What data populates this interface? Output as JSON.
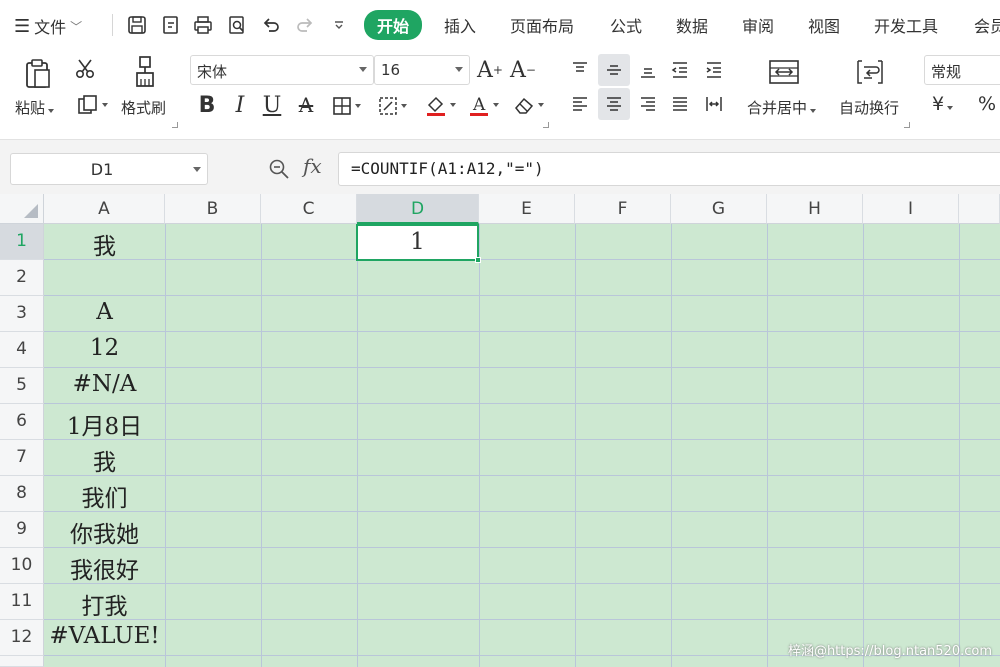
{
  "menubar": {
    "file_label": "文件",
    "tabs": [
      "开始",
      "插入",
      "页面布局",
      "公式",
      "数据",
      "审阅",
      "视图",
      "开发工具",
      "会员"
    ],
    "active_tab": "开始"
  },
  "ribbon": {
    "paste_label": "粘贴",
    "format_painter_label": "格式刷",
    "font_name": "宋体",
    "font_size": "16",
    "merge_label": "合并居中",
    "wrap_label": "自动换行",
    "number_format": "常规",
    "currency_symbol": "¥",
    "percent_symbol": "%"
  },
  "formula_bar": {
    "name_box": "D1",
    "fx_label": "fx",
    "formula": "=COUNTIF(A1:A12,\"=\")"
  },
  "grid": {
    "columns": [
      "A",
      "B",
      "C",
      "D",
      "E",
      "F",
      "G",
      "H",
      "I"
    ],
    "rows": [
      "1",
      "2",
      "3",
      "4",
      "5",
      "6",
      "7",
      "8",
      "9",
      "10",
      "11",
      "12"
    ],
    "selected_column": "D",
    "selected_row": "1",
    "column_a_values": [
      "我",
      "",
      "A",
      "12",
      "#N/A",
      "1月8日",
      "我",
      "我们",
      "你我她",
      "我很好",
      "打我",
      "#VALUE!"
    ],
    "d1_value": "1"
  },
  "watermark": "梓涵@https://blog.ntan520.com",
  "colors": {
    "accent": "#1fa562",
    "cell_background": "#cde8d1"
  }
}
